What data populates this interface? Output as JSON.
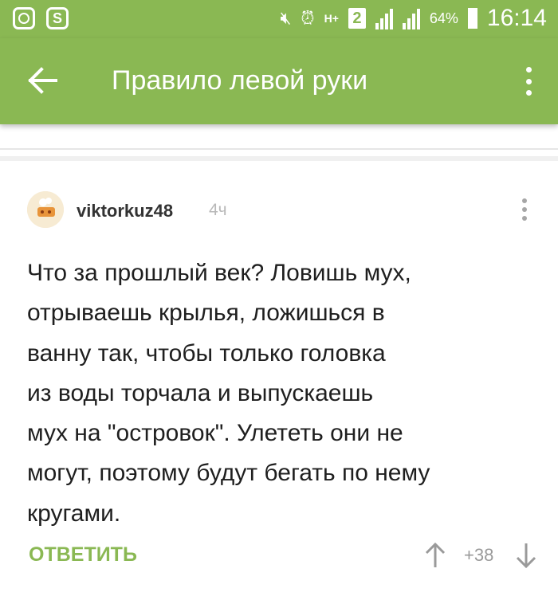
{
  "status_bar": {
    "network_label": "H+",
    "sim_label": "2",
    "battery": "64%",
    "time": "16:14"
  },
  "app_bar": {
    "title": "Правило левой руки"
  },
  "comment": {
    "author": "viktorkuz48",
    "age": "4ч",
    "lines": [
      "Что за прошлый век? Ловишь мух,",
      "отрываешь крылья, ложишься в",
      "ванну так, чтобы только головка",
      "из воды торчала и выпускаешь",
      "мух на \"островок\". Улететь они не",
      "могут, поэтому будут бегать по нему",
      "кругами."
    ],
    "reply_label": "ОТВЕТИТЬ",
    "score": "+38"
  },
  "colors": {
    "brand_green": "#8ab853",
    "text": "#1f1f1f",
    "muted": "#9a9a9a"
  }
}
